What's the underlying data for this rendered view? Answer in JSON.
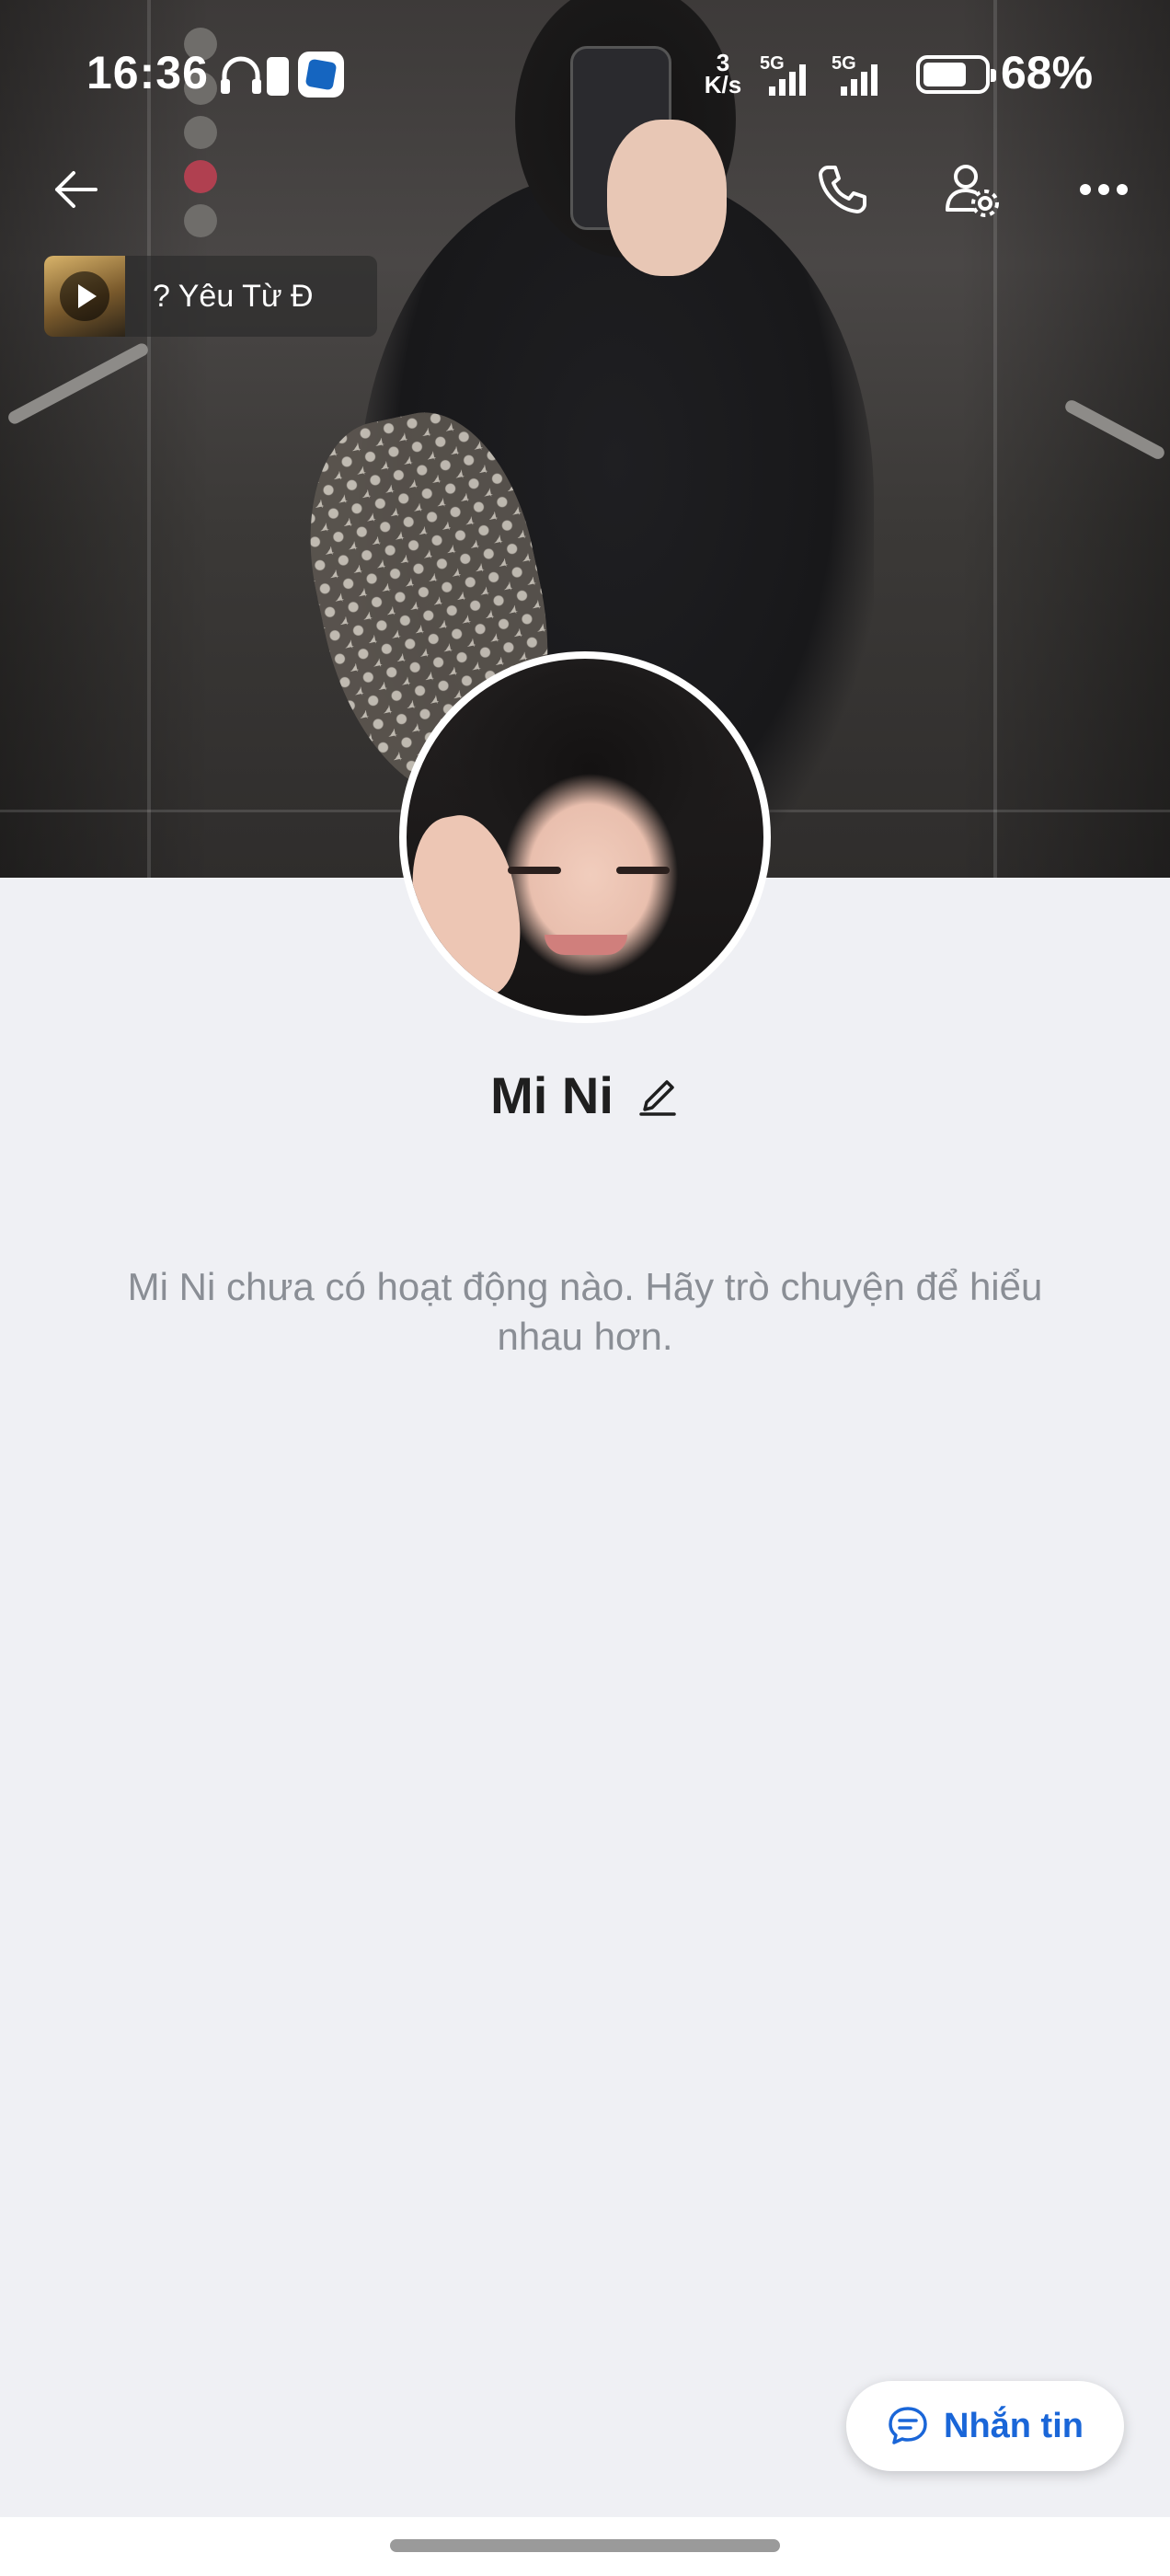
{
  "status_bar": {
    "time": "16:36",
    "net_speed_value": "3",
    "net_speed_unit": "K/s",
    "signal_1_tag": "5G",
    "signal_2_tag": "5G",
    "battery_percent": "68%",
    "icons": [
      "headphones-icon",
      "battery-saver-icon",
      "app-notification-icon",
      "signal-icon",
      "battery-icon"
    ]
  },
  "top_bar": {
    "icons": [
      "back-arrow-icon",
      "phone-call-icon",
      "user-settings-icon",
      "more-icon"
    ]
  },
  "music": {
    "title": "? Yêu Từ Đ"
  },
  "profile": {
    "name": "Mi Ni"
  },
  "empty_state": {
    "message": "Mi Ni chưa có hoạt động nào. Hãy trò chuyện để hiểu nhau hơn."
  },
  "fab": {
    "label": "Nhắn tin",
    "icon": "chat-bubble-icon"
  },
  "colors": {
    "accent": "#1a66d8",
    "background": "#eff0f4",
    "muted_text": "#8a8e95"
  }
}
